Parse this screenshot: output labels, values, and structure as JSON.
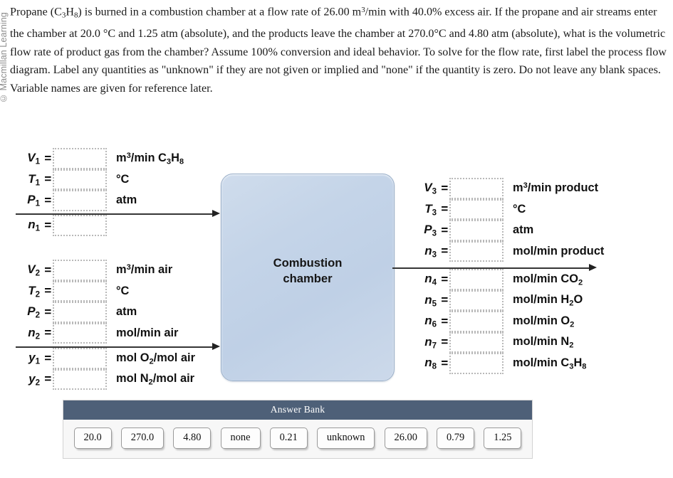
{
  "watermark": "© Macmillan Learning",
  "statement": {
    "html": "Propane (C<sub>3</sub>H<sub>8</sub>) is burned in a combustion chamber at a flow rate of 26.00 m<sup>3</sup>/min with 40.0% excess air. If the propane and air streams enter the chamber at 20.0 °C and 1.25 atm (absolute), and the products leave the chamber at 270.0°C and 4.80 atm (absolute), what is the volumetric flow rate of product gas from the chamber? Assume 100% conversion and ideal behavior. To solve for the flow rate, first label the process flow diagram. Label any quantities as \"unknown\" if they are not given or implied and \"none\" if the quantity is zero. Do not leave any blank spaces. Variable names are given for reference later."
  },
  "diagram": {
    "chamber_label": "Combustion\nchamber",
    "chamber_label_line1": "Combustion",
    "chamber_label_line2": "chamber",
    "stream1": {
      "rows_above": [
        {
          "var": "V",
          "sub": "1",
          "value": "",
          "unit_html": "m<sup>3</sup>/min C<sub>3</sub>H<sub>8</sub>"
        },
        {
          "var": "T",
          "sub": "1",
          "value": "",
          "unit_html": "°C"
        },
        {
          "var": "P",
          "sub": "1",
          "value": "",
          "unit_html": "atm"
        }
      ],
      "rows_below": [
        {
          "var": "n",
          "sub": "1",
          "value": "",
          "unit_html": ""
        }
      ]
    },
    "stream2": {
      "rows_above": [
        {
          "var": "V",
          "sub": "2",
          "value": "",
          "unit_html": "m<sup>3</sup>/min air"
        },
        {
          "var": "T",
          "sub": "2",
          "value": "",
          "unit_html": "°C"
        },
        {
          "var": "P",
          "sub": "2",
          "value": "",
          "unit_html": "atm"
        },
        {
          "var": "n",
          "sub": "2",
          "value": "",
          "unit_html": "mol/min air"
        }
      ],
      "rows_below": [
        {
          "var": "y",
          "sub": "1",
          "value": "",
          "unit_html": "mol O<sub>2</sub>/mol air"
        },
        {
          "var": "y",
          "sub": "2",
          "value": "",
          "unit_html": "mol N<sub>2</sub>/mol air"
        }
      ]
    },
    "stream3": {
      "rows_above": [
        {
          "var": "V",
          "sub": "3",
          "value": "",
          "unit_html": "m<sup>3</sup>/min product"
        },
        {
          "var": "T",
          "sub": "3",
          "value": "",
          "unit_html": "°C"
        },
        {
          "var": "P",
          "sub": "3",
          "value": "",
          "unit_html": "atm"
        },
        {
          "var": "n",
          "sub": "3",
          "value": "",
          "unit_html": "mol/min product"
        }
      ],
      "rows_below": [
        {
          "var": "n",
          "sub": "4",
          "value": "",
          "unit_html": "mol/min CO<sub>2</sub>"
        },
        {
          "var": "n",
          "sub": "5",
          "value": "",
          "unit_html": "mol/min H<sub>2</sub>O"
        },
        {
          "var": "n",
          "sub": "6",
          "value": "",
          "unit_html": "mol/min O<sub>2</sub>"
        },
        {
          "var": "n",
          "sub": "7",
          "value": "",
          "unit_html": "mol/min N<sub>2</sub>"
        },
        {
          "var": "n",
          "sub": "8",
          "value": "",
          "unit_html": "mol/min C<sub>3</sub>H<sub>8</sub>"
        }
      ]
    }
  },
  "answer_bank": {
    "title": "Answer Bank",
    "tokens": [
      "20.0",
      "270.0",
      "4.80",
      "none",
      "0.21",
      "unknown",
      "26.00",
      "0.79",
      "1.25"
    ],
    "header_color": "#4e6078"
  }
}
